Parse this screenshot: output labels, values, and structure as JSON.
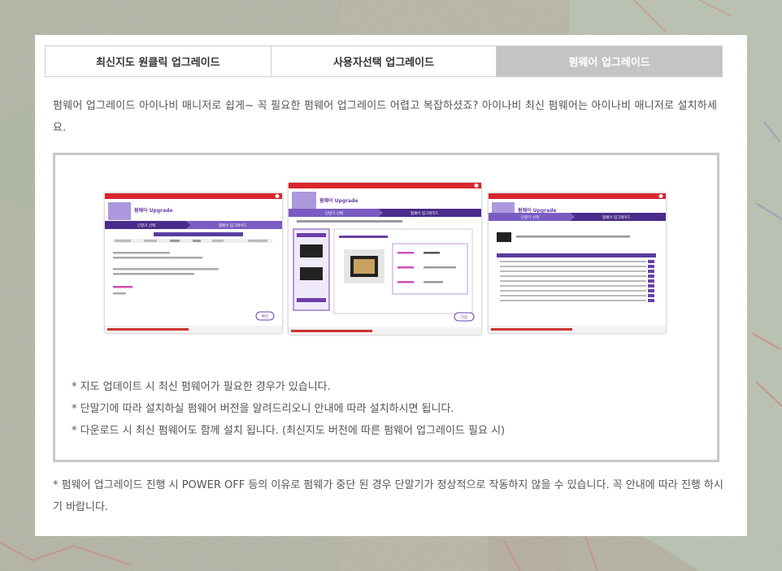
{
  "tabs": [
    {
      "label": "최신지도 원클릭 업그레이드",
      "active": false
    },
    {
      "label": "사용자선택 업그레이드",
      "active": false
    },
    {
      "label": "펌웨어 업그레이드",
      "active": true
    }
  ],
  "intro_text": "펌웨어 업그레이드 아이나비 매니저로 쉽게~ 꼭 필요한 펌웨어 업그레이드 어렵고 복잡하셨죠? 아이나비 최신 펌웨어는 아이나비 매니저로 설치하세요.",
  "screenshots": {
    "header_title": "펌웨어 Upgrade",
    "step1": "단말기 선택",
    "step2": "펌웨어 업그레이드",
    "next_button": "다음",
    "confirm_button": "확인"
  },
  "notes": [
    "* 지도 업데이트 시 최신 펌웨어가 필요한 경우가 있습니다.",
    "* 단말기에 따라 설치하실 펌웨어 버전을 알려드리오니 안내에 따라 설치하시면 됩니다.",
    "* 다운로드 시 최신 펌웨어도 함께 설치 됩니다. (최신지도 버전에 따른 펌웨어 업그레이드 필요 시)"
  ],
  "footer_note": "* 펌웨어 업그레이드 진행 시 POWER OFF 등의 이유로 펌웨가 중단 된 경우 단말기가 정상적으로 작동하지 않을 수 있습니다. 꼭 안내에 따라 진행 하시기 바랍니다.",
  "colors": {
    "accent": "#6b3fa8",
    "tab_active_bg": "#c4c4c4",
    "title_bar": "#d9262c"
  }
}
